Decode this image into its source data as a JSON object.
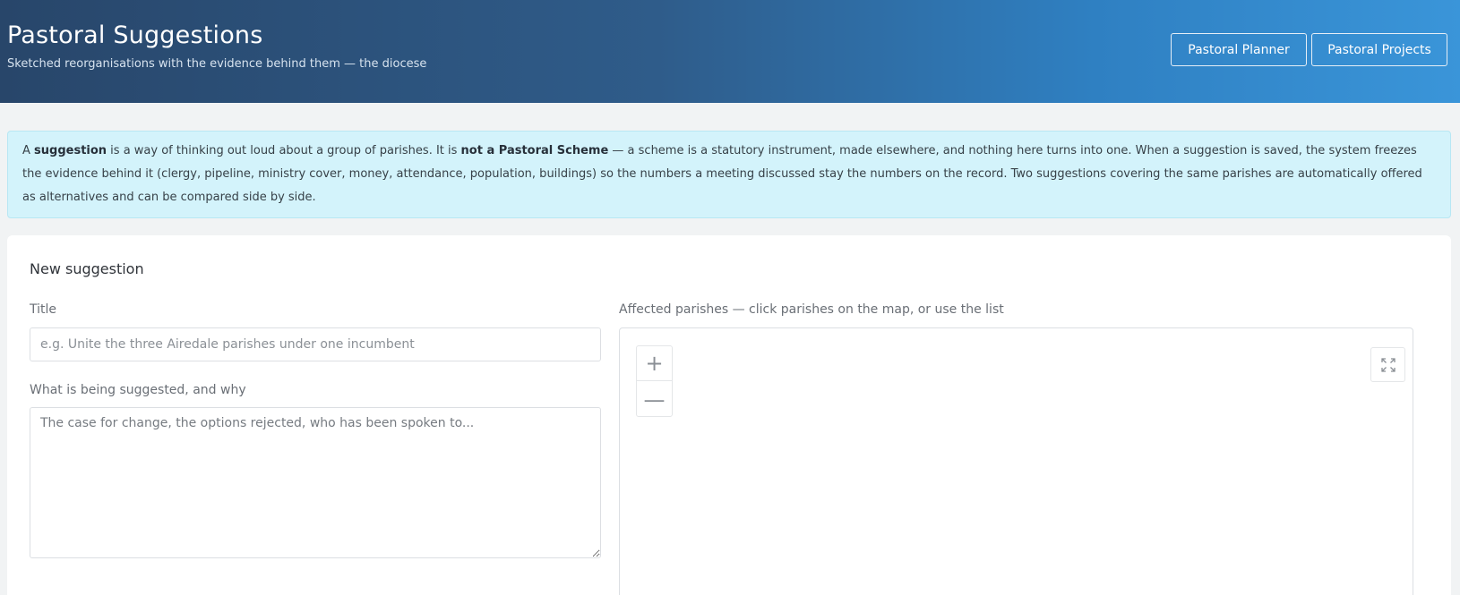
{
  "header": {
    "title": "Pastoral Suggestions",
    "subtitle": "Sketched reorganisations with the evidence behind them — the diocese",
    "buttons": {
      "planner": "Pastoral Planner",
      "projects": "Pastoral Projects"
    }
  },
  "info": {
    "p1": "A ",
    "b1": "suggestion",
    "p2": " is a way of thinking out loud about a group of parishes. It is ",
    "b2": "not a Pastoral Scheme",
    "p3": " — a scheme is a statutory instrument, made elsewhere, and nothing here turns into one. When a suggestion is saved, the system freezes the evidence behind it (clergy, pipeline, ministry cover, money, attendance, population, buildings) so the numbers a meeting discussed stay the numbers on the record. Two suggestions covering the same parishes are automatically offered as alternatives and can be compared side by side."
  },
  "form": {
    "heading": "New suggestion",
    "title_label": "Title",
    "title_placeholder": "e.g. Unite the three Airedale parishes under one incumbent",
    "title_value": "",
    "why_label": "What is being suggested, and why",
    "why_placeholder": "The case for change, the options rejected, who has been spoken to...",
    "why_value": "",
    "parishes_label": "Affected parishes — click parishes on the map, or use the list"
  },
  "map": {
    "zoom_in": "+",
    "zoom_out": "—",
    "icons": {
      "zoom_in": "plus-icon",
      "zoom_out": "minus-icon",
      "fullscreen": "fullscreen-icon"
    }
  }
}
